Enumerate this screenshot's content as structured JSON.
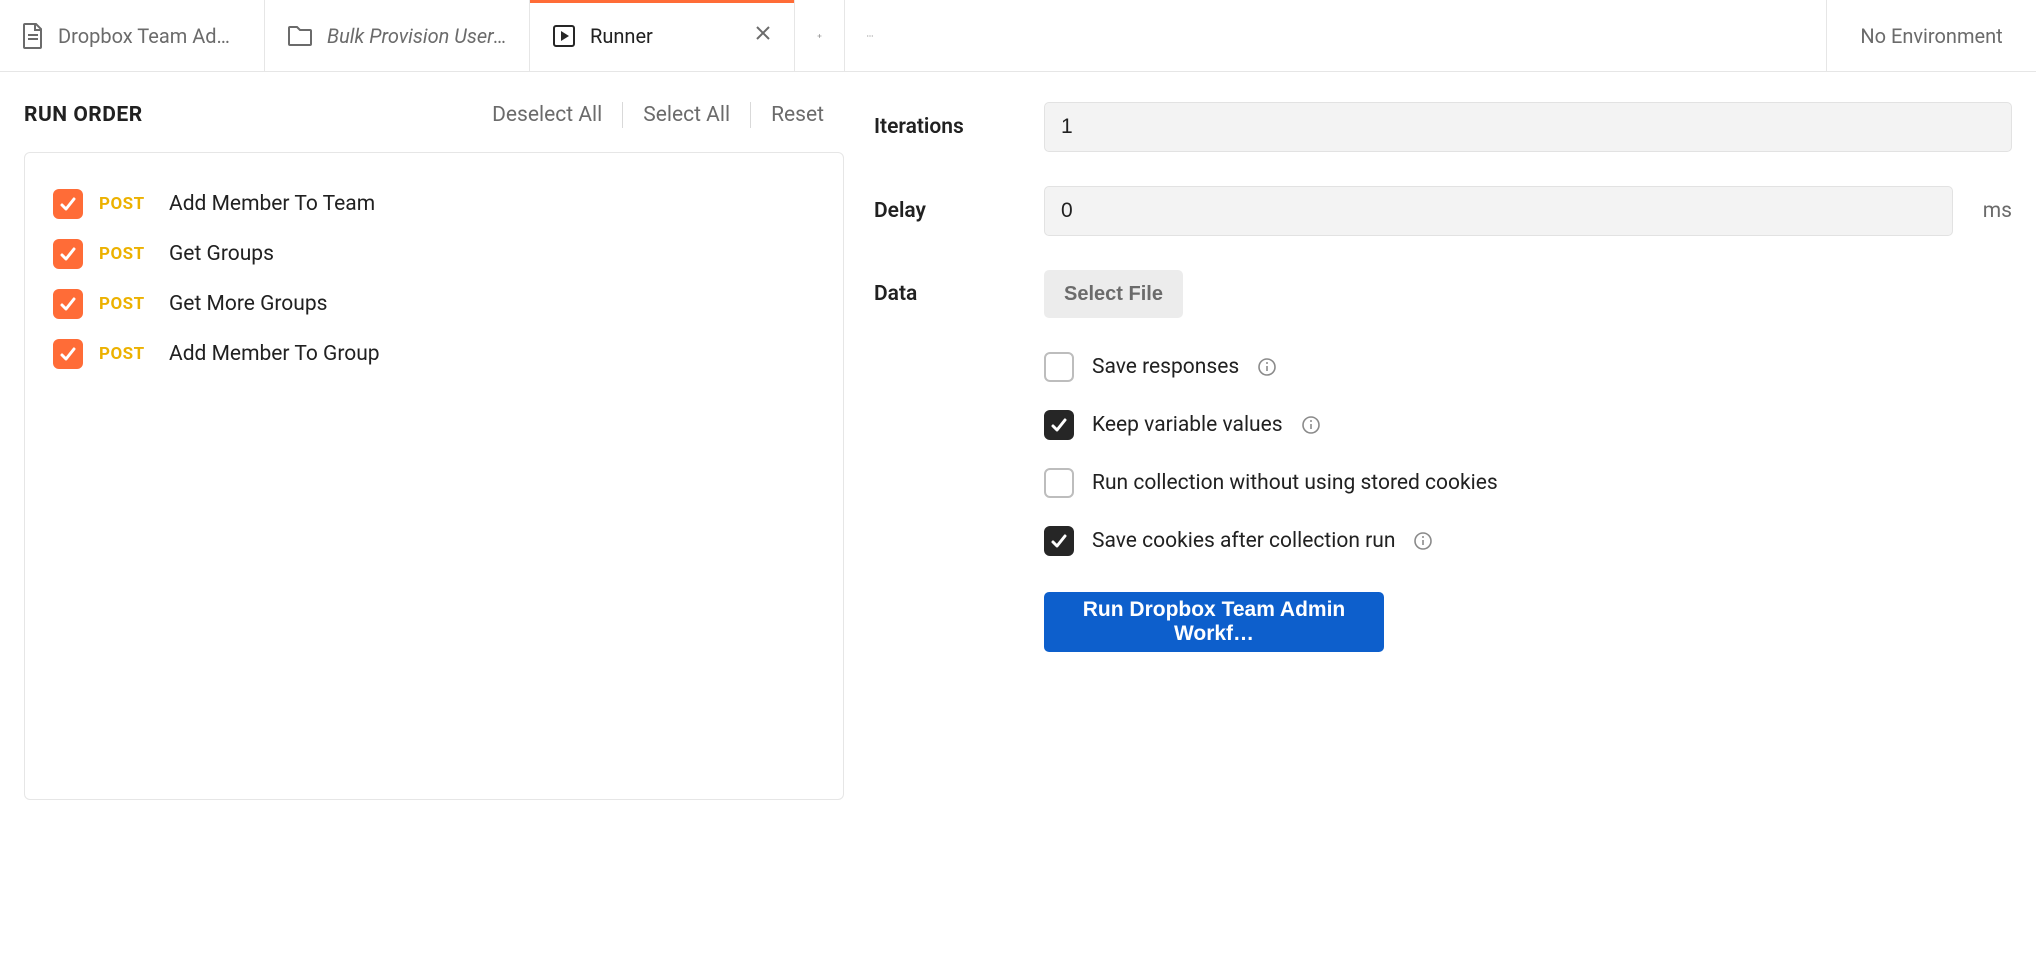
{
  "tabs": {
    "t0": {
      "label": "Dropbox Team Admi…"
    },
    "t1": {
      "label": "Bulk Provision Users …"
    },
    "t2": {
      "label": "Runner"
    }
  },
  "env_label": "No Environment",
  "left": {
    "title": "RUN ORDER",
    "actions": {
      "deselect": "Deselect All",
      "select": "Select All",
      "reset": "Reset"
    },
    "requests": [
      {
        "method": "POST",
        "name": "Add Member To Team",
        "checked": true
      },
      {
        "method": "POST",
        "name": "Get Groups",
        "checked": true
      },
      {
        "method": "POST",
        "name": "Get More Groups",
        "checked": true
      },
      {
        "method": "POST",
        "name": "Add Member To Group",
        "checked": true
      }
    ]
  },
  "right": {
    "iterations": {
      "label": "Iterations",
      "value": "1"
    },
    "delay": {
      "label": "Delay",
      "value": "0",
      "unit": "ms"
    },
    "data": {
      "label": "Data",
      "button": "Select File"
    },
    "options": [
      {
        "label": "Save responses",
        "checked": false,
        "info": true
      },
      {
        "label": "Keep variable values",
        "checked": true,
        "info": true
      },
      {
        "label": "Run collection without using stored cookies",
        "checked": false,
        "info": false
      },
      {
        "label": "Save cookies after collection run",
        "checked": true,
        "info": true
      }
    ],
    "run_button": "Run Dropbox Team Admin Workf…"
  }
}
